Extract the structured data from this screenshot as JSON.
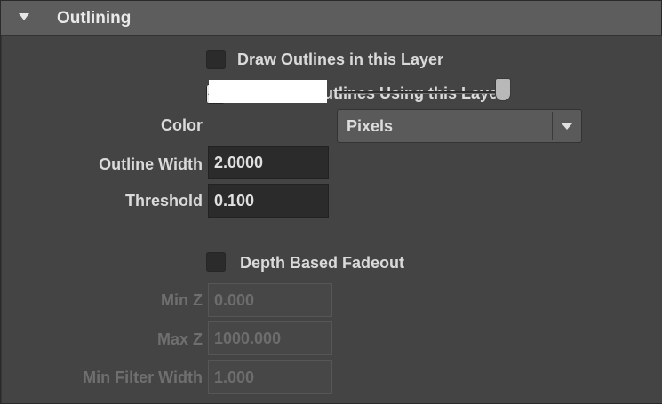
{
  "section": {
    "title": "Outlining",
    "expand_icon": "triangle-down-icon"
  },
  "draw_outlines": {
    "label": "Draw Outlines in this Layer",
    "checked": false
  },
  "generate_outlines": {
    "label": "Generate Outlines Using this Layer",
    "checked": true
  },
  "color": {
    "label": "Color",
    "value": "#ffffff",
    "slider_fraction": 1.0
  },
  "outline_width": {
    "label": "Outline Width",
    "value": "2.0000",
    "unit": "Pixels"
  },
  "threshold": {
    "label": "Threshold",
    "value": "0.100"
  },
  "depth_fadeout": {
    "label": "Depth Based Fadeout",
    "checked": false
  },
  "min_z": {
    "label": "Min Z",
    "value": "0.000"
  },
  "max_z": {
    "label": "Max Z",
    "value": "1000.000"
  },
  "min_filter_width": {
    "label": "Min Filter Width",
    "value": "1.000"
  }
}
